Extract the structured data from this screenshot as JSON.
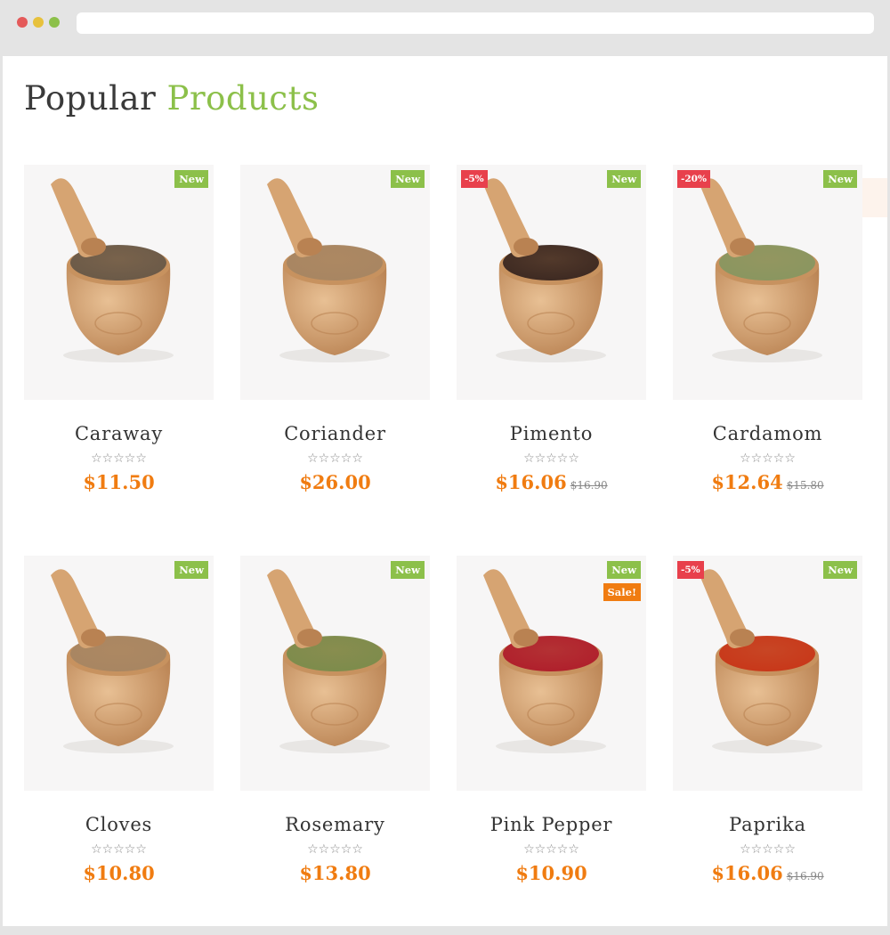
{
  "heading": {
    "part1": "Popular",
    "part2": "Products"
  },
  "colors": {
    "accent": "#8cc04a",
    "price": "#f07c11",
    "discount": "#e8404c",
    "new_badge": "#8cc04a",
    "sale_badge": "#f07c11"
  },
  "products": [
    {
      "name": "Caraway",
      "price": "$11.50",
      "old_price": "",
      "badge_new": "New",
      "badge_discount": "",
      "badge_sale": "",
      "rating_stars": "☆☆☆☆☆",
      "spice_color": "#6b5a48"
    },
    {
      "name": "Coriander",
      "price": "$26.00",
      "old_price": "",
      "badge_new": "New",
      "badge_discount": "",
      "badge_sale": "",
      "rating_stars": "☆☆☆☆☆",
      "spice_color": "#a88662"
    },
    {
      "name": "Pimento",
      "price": "$16.06",
      "old_price": "$16.90",
      "badge_new": "New",
      "badge_discount": "-5%",
      "badge_sale": "",
      "rating_stars": "☆☆☆☆☆",
      "spice_color": "#3e2a22"
    },
    {
      "name": "Cardamom",
      "price": "$12.64",
      "old_price": "$15.80",
      "badge_new": "New",
      "badge_discount": "-20%",
      "badge_sale": "",
      "rating_stars": "☆☆☆☆☆",
      "spice_color": "#8a9660"
    },
    {
      "name": "Cloves",
      "price": "$10.80",
      "old_price": "",
      "badge_new": "New",
      "badge_discount": "",
      "badge_sale": "",
      "rating_stars": "☆☆☆☆☆",
      "spice_color": "#a88662"
    },
    {
      "name": "Rosemary",
      "price": "$13.80",
      "old_price": "",
      "badge_new": "New",
      "badge_discount": "",
      "badge_sale": "",
      "rating_stars": "☆☆☆☆☆",
      "spice_color": "#7d8c4c"
    },
    {
      "name": "Pink Pepper",
      "price": "$10.90",
      "old_price": "",
      "badge_new": "New",
      "badge_discount": "",
      "badge_sale": "Sale!",
      "rating_stars": "☆☆☆☆☆",
      "spice_color": "#b0202c"
    },
    {
      "name": "Paprika",
      "price": "$16.06",
      "old_price": "$16.90",
      "badge_new": "New",
      "badge_discount": "-5%",
      "badge_sale": "",
      "rating_stars": "☆☆☆☆☆",
      "spice_color": "#c8381a"
    }
  ]
}
